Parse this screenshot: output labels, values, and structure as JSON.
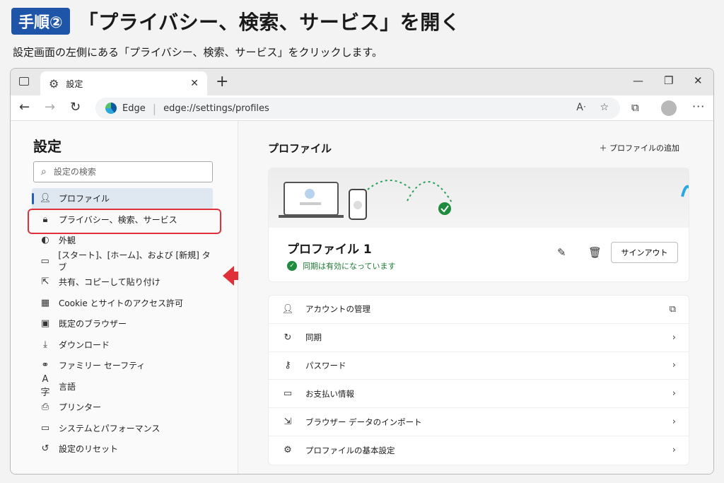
{
  "header": {
    "badge": "手順②",
    "title": "「プライバシー、検索、サービス」を開く",
    "subtitle": "設定画面の左側にある「プライバシー、検索、サービス」をクリックします。"
  },
  "browser": {
    "tab_label": "設定",
    "url_brand": "Edge",
    "url": "edge://settings/profiles"
  },
  "sidebar": {
    "title": "設定",
    "search_placeholder": "設定の検索",
    "items": [
      {
        "label": "プロファイル",
        "icon": "person-icon"
      },
      {
        "label": "プライバシー、検索、サービス",
        "icon": "lock-icon"
      },
      {
        "label": "外観",
        "icon": "palette-icon"
      },
      {
        "label": "[スタート]、[ホーム]、および [新規] タブ",
        "icon": "home-tab-icon"
      },
      {
        "label": "共有、コピーして貼り付け",
        "icon": "share-icon"
      },
      {
        "label": "Cookie とサイトのアクセス許可",
        "icon": "cookie-icon"
      },
      {
        "label": "既定のブラウザー",
        "icon": "browser-icon"
      },
      {
        "label": "ダウンロード",
        "icon": "download-icon"
      },
      {
        "label": "ファミリー セーフティ",
        "icon": "family-icon"
      },
      {
        "label": "言語",
        "icon": "language-icon"
      },
      {
        "label": "プリンター",
        "icon": "printer-icon"
      },
      {
        "label": "システムとパフォーマンス",
        "icon": "laptop-icon"
      },
      {
        "label": "設定のリセット",
        "icon": "reset-icon"
      }
    ]
  },
  "main": {
    "title": "プロファイル",
    "add_profile": "プロファイルの追加",
    "profile_name": "プロファイル 1",
    "sync_status": "同期は有効になっています",
    "signout": "サインアウト",
    "rows": [
      {
        "label": "アカウントの管理",
        "icon": "person-icon",
        "end": "external-link-icon"
      },
      {
        "label": "同期",
        "icon": "sync-icon",
        "end": "chevron-right-icon"
      },
      {
        "label": "パスワード",
        "icon": "key-icon",
        "end": "chevron-right-icon"
      },
      {
        "label": "お支払い情報",
        "icon": "card-icon",
        "end": "chevron-right-icon"
      },
      {
        "label": "ブラウザー データのインポート",
        "icon": "import-icon",
        "end": "chevron-right-icon"
      },
      {
        "label": "プロファイルの基本設定",
        "icon": "gear-icon",
        "end": "chevron-right-icon"
      }
    ]
  },
  "colors": {
    "accent": "#1f55a8",
    "highlight": "#e0303a",
    "sync_green": "#1f8b3e"
  }
}
